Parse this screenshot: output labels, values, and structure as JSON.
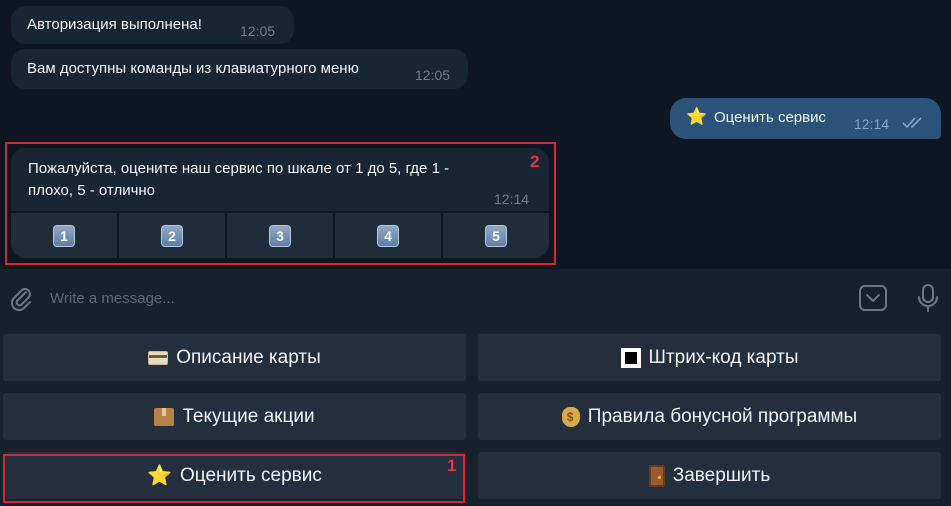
{
  "messages": {
    "m1": {
      "text": "Авторизация выполнена!",
      "time": "12:05"
    },
    "m2": {
      "text": "Вам доступны команды из клавиатурного меню",
      "time": "12:05"
    },
    "outgoing": {
      "emoji": "⭐",
      "text": "Оценить сервис",
      "time": "12:14"
    },
    "rating_prompt": {
      "text": "Пожалуйста, оцените наш сервис по шкале от 1 до 5, где 1 - плохо, 5 - отлично",
      "time": "12:14"
    }
  },
  "inline_keyboard": [
    "1",
    "2",
    "3",
    "4",
    "5"
  ],
  "annotations": {
    "label_1": "1",
    "label_2": "2",
    "color": "#d7272d"
  },
  "composer": {
    "placeholder": "Write a message..."
  },
  "reply_keyboard": {
    "card_description": {
      "icon": "credit-card-icon",
      "label": "Описание карты"
    },
    "card_barcode": {
      "icon": "black-square-icon",
      "label": "Штрих-код карты"
    },
    "current_promos": {
      "icon": "package-icon",
      "label": "Текущие акции"
    },
    "bonus_rules": {
      "icon": "money-bag-icon",
      "label": "Правила бонусной программы"
    },
    "rate_service": {
      "icon": "star-icon",
      "label": "Оценить сервис"
    },
    "finish": {
      "icon": "door-icon",
      "label": "Завершить"
    }
  },
  "colors": {
    "background": "#0e1621",
    "incoming_bubble": "#182533",
    "outgoing_bubble": "#2b5278",
    "panel": "#17212b",
    "button": "#232f3d"
  }
}
